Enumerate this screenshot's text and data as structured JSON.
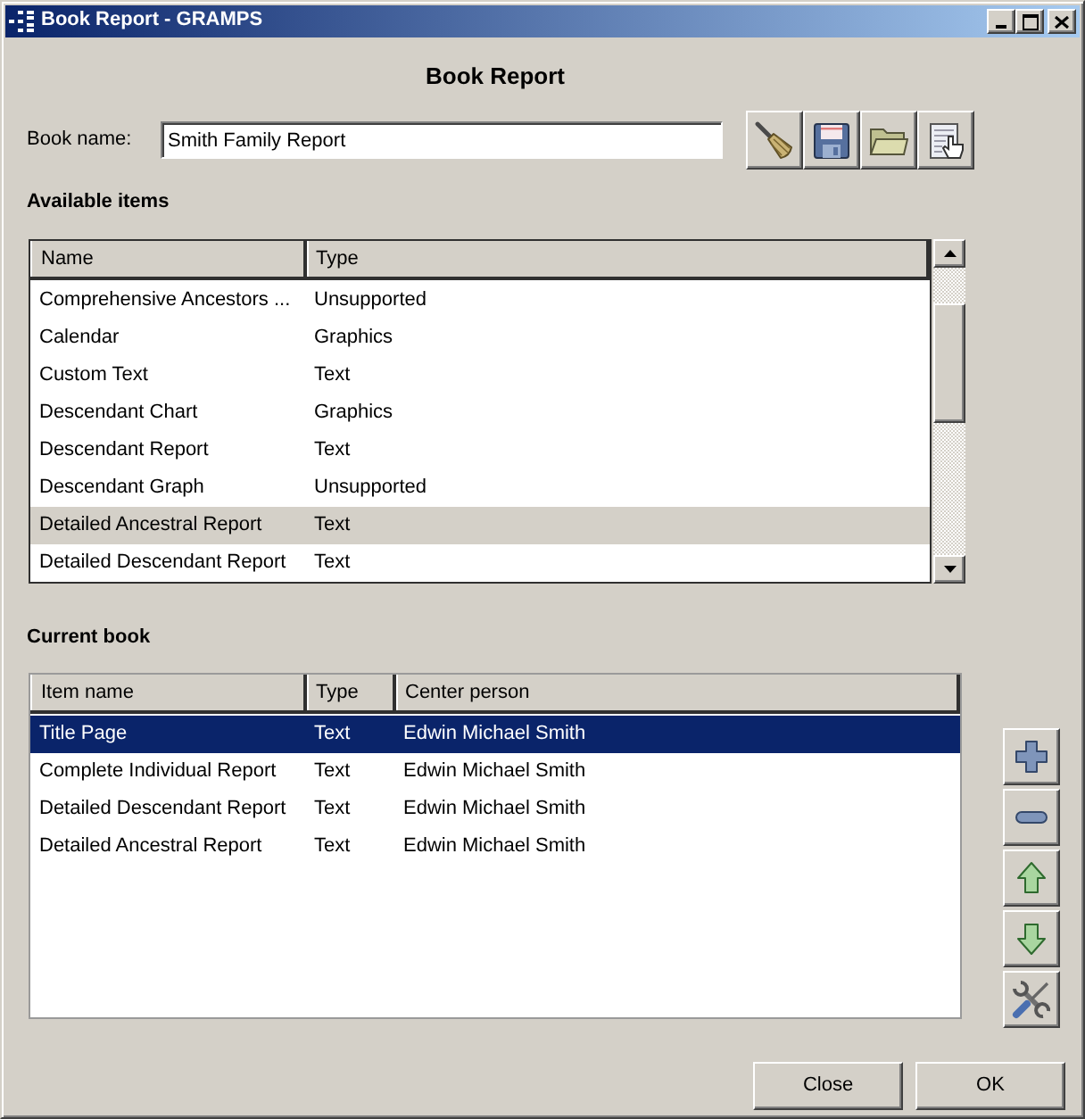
{
  "window": {
    "title": "Book Report - GRAMPS"
  },
  "heading": "Book Report",
  "book_name": {
    "label": "Book name:",
    "value": "Smith Family Report"
  },
  "available_items": {
    "label": "Available items",
    "focused": false,
    "columns": [
      "Name",
      "Type"
    ],
    "rows": [
      {
        "name": "Comprehensive Ancestors ...",
        "type": "Unsupported",
        "selected": false
      },
      {
        "name": "Calendar",
        "type": "Graphics",
        "selected": false
      },
      {
        "name": "Custom Text",
        "type": "Text",
        "selected": false
      },
      {
        "name": "Descendant Chart",
        "type": "Graphics",
        "selected": false
      },
      {
        "name": "Descendant Report",
        "type": "Text",
        "selected": false
      },
      {
        "name": "Descendant Graph",
        "type": "Unsupported",
        "selected": false
      },
      {
        "name": "Detailed Ancestral Report",
        "type": "Text",
        "selected": true
      },
      {
        "name": "Detailed Descendant Report",
        "type": "Text",
        "selected": false
      }
    ]
  },
  "current_book": {
    "label": "Current book",
    "focused": true,
    "columns": [
      "Item name",
      "Type",
      "Center person"
    ],
    "rows": [
      {
        "item_name": "Title Page",
        "type": "Text",
        "center_person": "Edwin Michael Smith",
        "selected": true
      },
      {
        "item_name": "Complete Individual Report",
        "type": "Text",
        "center_person": "Edwin Michael Smith",
        "selected": false
      },
      {
        "item_name": "Detailed Descendant Report",
        "type": "Text",
        "center_person": "Edwin Michael Smith",
        "selected": false
      },
      {
        "item_name": "Detailed Ancestral Report",
        "type": "Text",
        "center_person": "Edwin Michael Smith",
        "selected": false
      }
    ]
  },
  "buttons": [
    {
      "label": "Close"
    },
    {
      "label": "OK"
    }
  ]
}
